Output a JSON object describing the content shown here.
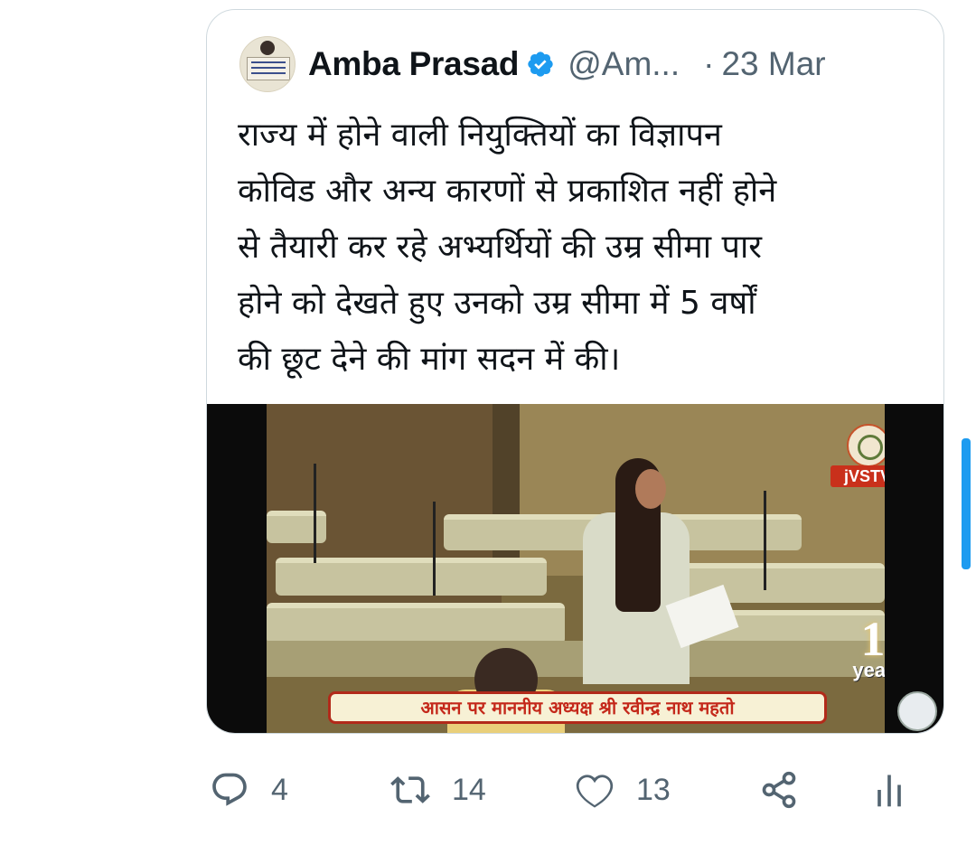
{
  "tweet": {
    "author_name": "Amba Prasad",
    "handle": "@Am...",
    "dot": "·",
    "date": "23 Mar",
    "text": [
      "राज्य में होने वाली नियुक्तियों का विज्ञापन",
      "कोविड और अन्य कारणों से प्रकाशित नहीं होने",
      "से तैयारी कर रहे अभ्यर्थियों की उम्र सीमा पार",
      "होने को देखते हुए उनको उम्र सीमा में 5 वर्षों",
      "की छूट देने की मांग सदन में की।"
    ],
    "verified_color": "#1d9bf0"
  },
  "media": {
    "channel_label": "jVSTV",
    "anniversary_number": "1",
    "anniversary_label": "year",
    "ticker_text": "आसन पर माननीय अध्यक्ष श्री रवीन्द्र नाथ महतो"
  },
  "actions": {
    "reply_count": "4",
    "retweet_count": "14",
    "like_count": "13"
  },
  "icons": {
    "reply": "reply-icon",
    "retweet": "retweet-icon",
    "like": "heart-icon",
    "share": "share-icon",
    "analytics": "analytics-icon",
    "verified": "verified-badge-icon"
  }
}
